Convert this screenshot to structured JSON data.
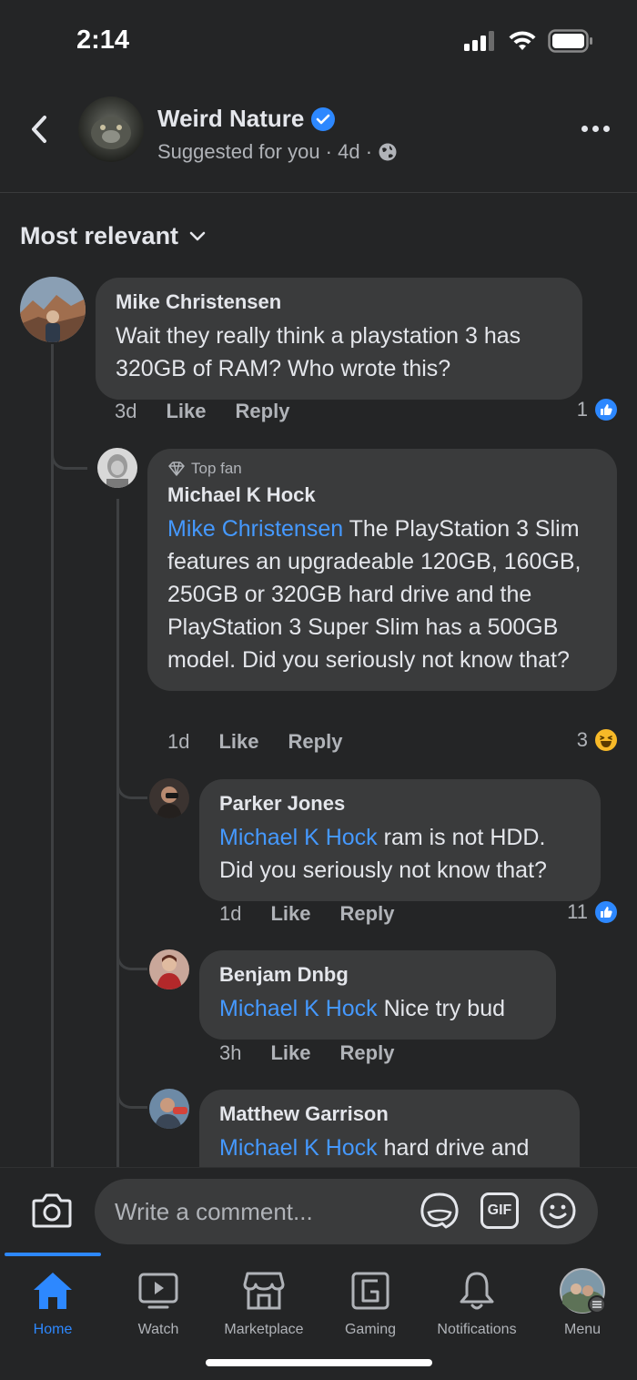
{
  "status_bar": {
    "time": "2:14"
  },
  "header": {
    "page_name": "Weird Nature",
    "meta": "Suggested for you · 4d ·"
  },
  "sort": {
    "label": "Most relevant"
  },
  "comments": [
    {
      "author": "Mike Christensen",
      "text": "Wait they really think a playstation 3 has 320GB of RAM? Who wrote this?",
      "time": "3d",
      "like": "Like",
      "reply": "Reply",
      "reaction_count": "1",
      "reaction": "like"
    },
    {
      "badge": "Top fan",
      "author": "Michael K Hock",
      "mention": "Mike Christensen",
      "text": " The PlayStation 3 Slim features an upgradeable 120GB, 160GB, 250GB or 320GB hard drive and the PlayStation 3 Super Slim has a 500GB model. Did you seriously not know that?",
      "time": "1d",
      "like": "Like",
      "reply": "Reply",
      "reaction_count": "3",
      "reaction": "haha"
    },
    {
      "author": "Parker Jones",
      "mention": "Michael K Hock",
      "text": " ram is not HDD. Did you seriously not know that?",
      "time": "1d",
      "like": "Like",
      "reply": "Reply",
      "reaction_count": "11",
      "reaction": "like"
    },
    {
      "author": "Benjam Dnbg",
      "mention": "Michael K Hock",
      "text": " Nice try bud",
      "time": "3h",
      "like": "Like",
      "reply": "Reply"
    },
    {
      "author": "Matthew Garrison",
      "mention": "Michael K Hock",
      "text": " hard drive and"
    }
  ],
  "composer": {
    "placeholder": "Write a comment...",
    "gif_label": "GIF"
  },
  "tabs": [
    {
      "label": "Home",
      "icon": "home-icon",
      "active": true
    },
    {
      "label": "Watch",
      "icon": "watch-icon"
    },
    {
      "label": "Marketplace",
      "icon": "marketplace-icon"
    },
    {
      "label": "Gaming",
      "icon": "gaming-icon"
    },
    {
      "label": "Notifications",
      "icon": "bell-icon"
    },
    {
      "label": "Menu",
      "icon": "menu-avatar-icon"
    }
  ],
  "colors": {
    "accent": "#2d88ff",
    "mention": "#4599ff",
    "background": "#242526",
    "bubble": "#3a3b3c",
    "haha": "#f7b928"
  }
}
